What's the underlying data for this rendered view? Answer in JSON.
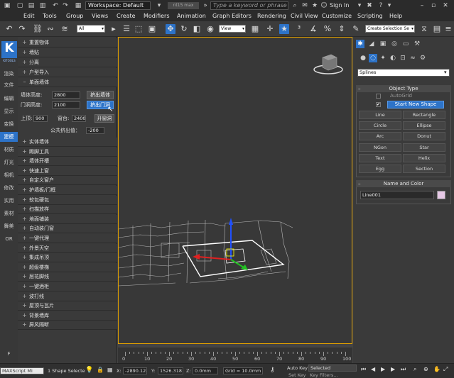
{
  "titlebar": {
    "workspace": "Workspace: Default",
    "filename": "nt15 max",
    "search_placeholder": "Type a keyword or phrase",
    "sign_in": "Sign In"
  },
  "menubar": [
    "Edit",
    "Tools",
    "Group",
    "Views",
    "Create",
    "Modifiers",
    "Animation",
    "Graph Editors",
    "Rendering",
    "Civil View",
    "Customize",
    "Scripting",
    "Help"
  ],
  "toolbar": {
    "selection_filter": "All",
    "ref_coord": "View",
    "named_selection": "Create Selection Se"
  },
  "tabstrip": {
    "logo_letter": "K",
    "logo_sub": "KITOOLS",
    "tabs": [
      "渲染",
      "文件",
      "编辑",
      "显示",
      "变换",
      "建模",
      "材质",
      "灯光",
      "相机",
      "修改",
      "实用",
      "素材",
      "舞美",
      "OR",
      "F"
    ]
  },
  "plugin": {
    "top_items": [
      "重置物体",
      "墙贴",
      "分离",
      "户型导入",
      "单面墙体"
    ],
    "wall_height_label": "墙体高度:",
    "wall_height_value": "2800",
    "door_height_label": "门洞高度:",
    "door_height_value": "2100",
    "extrude_wall_btn": "挤出墙体",
    "extrude_door_btn": "挤出门洞",
    "top_label": "上顶:",
    "top_value": "900",
    "sill_label": "窗台:",
    "sill_value": "2400",
    "window_btn": "开窗洞",
    "ceiling_label": "公共挤出值：",
    "ceiling_value": "-200",
    "more_items": [
      "实体墙体",
      "踢脚工具",
      "墙体开槽",
      "快速上窗",
      "自定义窗户",
      "护墙板/门框",
      "软包硬包",
      "扫描放样",
      "地面铺装",
      "自动装门窗",
      "一键代理",
      "外景天空",
      "集成吊顶",
      "超级楼梯",
      "层花脚线",
      "一键酒柜",
      "波打线",
      "屋顶与瓦片",
      "背景墙库",
      "屏风隔断"
    ]
  },
  "timeline": {
    "ticks": [
      "0",
      "10",
      "20",
      "30",
      "40",
      "50",
      "60",
      "70",
      "80",
      "90",
      "100"
    ]
  },
  "cmdpanel": {
    "category": "Splines",
    "object_type_header": "Object Type",
    "autogrid": "AutoGrid",
    "start_new_shape": "Start New Shape",
    "buttons": [
      "Line",
      "Rectangle",
      "Circle",
      "Ellipse",
      "Arc",
      "Donut",
      "NGon",
      "Star",
      "Text",
      "Helix",
      "Egg",
      "Section"
    ],
    "name_color_header": "Name and Color",
    "object_name": "Line001",
    "object_color": "#e6c8e6"
  },
  "statusbar": {
    "maxscript": "MAXScript Mi",
    "selection": "1 Shape Selecte",
    "x_label": "X:",
    "x_value": "-2890.128",
    "y_label": "Y:",
    "y_value": "1526.318",
    "z_label": "Z:",
    "z_value": "0.0mm",
    "grid": "Grid = 10.0mm",
    "autokey": "Auto Key",
    "selected": "Selected",
    "setkey": "Set Key",
    "keyfilters": "Key Filters..."
  },
  "colors": {
    "accent": "#2d73c8",
    "viewport_border": "#e0a000",
    "gizmo_x": "#e02020",
    "gizmo_y": "#20c020",
    "gizmo_z": "#2050ff"
  }
}
